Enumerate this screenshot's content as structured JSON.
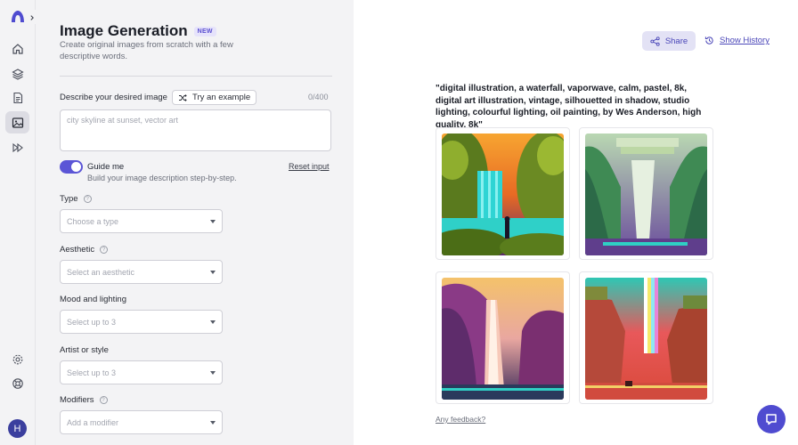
{
  "header": {
    "title": "Image Generation",
    "badge": "NEW",
    "subtitle": "Create original images from scratch with a few descriptive words."
  },
  "description": {
    "label": "Describe your desired image",
    "try_example": "Try an example",
    "counter": "0/400",
    "placeholder": "city skyline at sunset, vector art"
  },
  "guide": {
    "label": "Guide me",
    "sub": "Build your image description step-by-step.",
    "reset": "Reset input",
    "enabled": true
  },
  "fields": [
    {
      "label": "Type",
      "placeholder": "Choose a type",
      "help": true
    },
    {
      "label": "Aesthetic",
      "placeholder": "Select an aesthetic",
      "help": true
    },
    {
      "label": "Mood and lighting",
      "placeholder": "Select up to 3",
      "help": false
    },
    {
      "label": "Artist or style",
      "placeholder": "Select up to 3",
      "help": false
    },
    {
      "label": "Modifiers",
      "placeholder": "Add a modifier",
      "help": true
    }
  ],
  "user": {
    "avatar_initial": "H"
  },
  "results": {
    "share": "Share",
    "show_history": "Show History",
    "prompt": "\"digital illustration, a waterfall, vaporwave, calm, pastel, 8k, digital art illustration, vintage, silhouetted in shadow, studio lighting, colourful lighting, oil painting, by Wes Anderson, high quality, 8k\"",
    "feedback": "Any feedback?"
  },
  "colors": {
    "accent": "#5b55d6",
    "chat": "#4f4bd0"
  },
  "icons": [
    "logo-icon",
    "chevron-right-icon",
    "home-icon",
    "layers-icon",
    "document-icon",
    "image-icon",
    "fast-forward-icon",
    "settings-icon",
    "help-ring-icon",
    "shuffle-icon",
    "share-icon",
    "history-icon",
    "chat-icon"
  ]
}
